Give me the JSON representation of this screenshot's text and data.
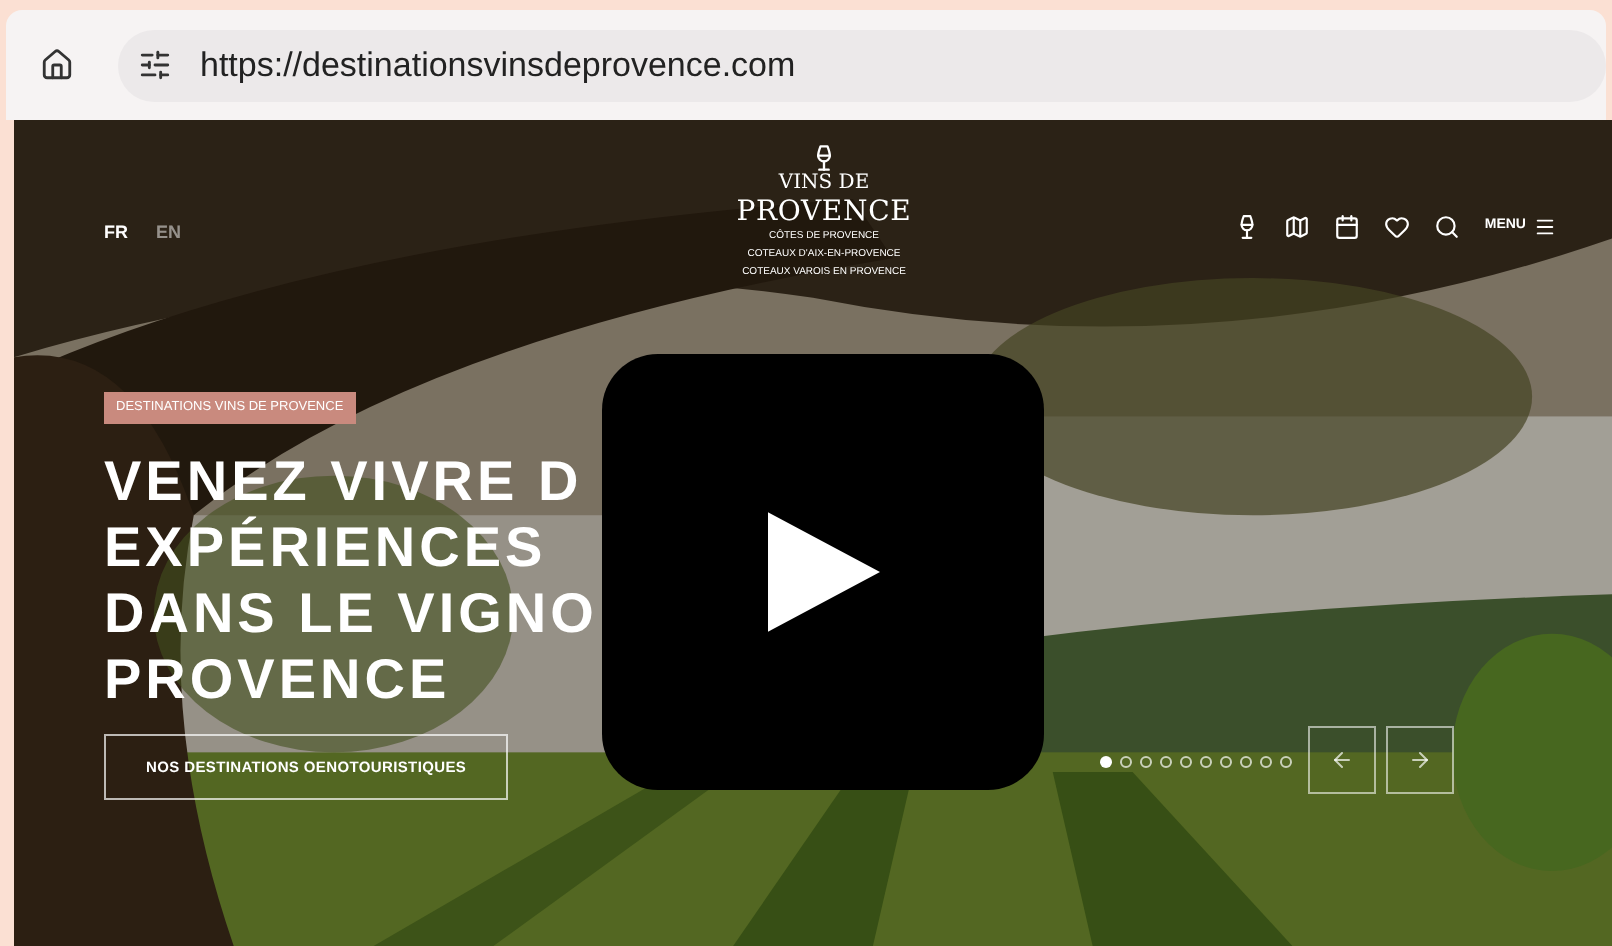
{
  "browser": {
    "url": "https://destinationsvinsdeprovence.com"
  },
  "header": {
    "languages": [
      {
        "label": "FR",
        "selected": true
      },
      {
        "label": "EN",
        "selected": false
      }
    ],
    "logo": {
      "line_1": "VINS DE",
      "line_2": "PROVENCE",
      "appellations": [
        "CÔTES DE PROVENCE",
        "COTEAUX D'AIX-EN-PROVENCE",
        "COTEAUX VAROIS EN PROVENCE"
      ]
    },
    "menu_label": "MENU"
  },
  "hero": {
    "badge": "DESTINATIONS VINS DE PROVENCE",
    "headline": [
      "VENEZ VIVRE D",
      "EXPÉRIENCES",
      "DANS LE VIGNO",
      "PROVENCE"
    ],
    "cta": "NOS DESTINATIONS OENOTOURISTIQUES",
    "slides": [
      {
        "selected": true
      },
      {
        "selected": false
      },
      {
        "selected": false
      },
      {
        "selected": false
      },
      {
        "selected": false
      },
      {
        "selected": false
      },
      {
        "selected": false
      },
      {
        "selected": false
      },
      {
        "selected": false
      },
      {
        "selected": false
      }
    ]
  }
}
